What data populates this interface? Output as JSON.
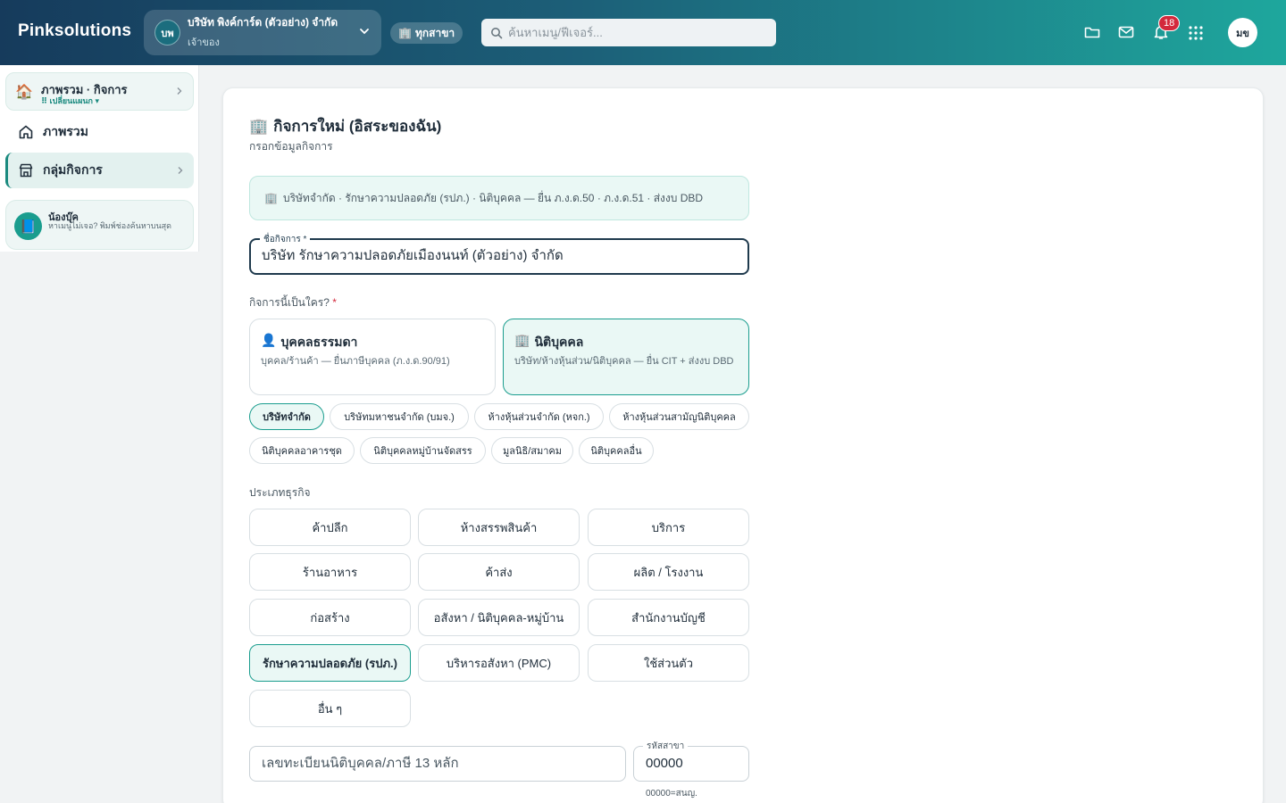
{
  "header": {
    "brand": "Pinksolutions",
    "company_initials": "บพ",
    "company_name": "บริษัท พิงค์การ์ด (ตัวอย่าง) จำกัด",
    "company_role": "เจ้าของ",
    "branch_label": "ทุกสาขา",
    "search_placeholder": "ค้นหาเมนู/ฟีเจอร์...",
    "notification_count": "18",
    "user_initials": "มข"
  },
  "sidebar": {
    "workspace_title": "ภาพรวม · กิจการ",
    "workspace_switch": "⠿ เปลี่ยนแผนก ▾",
    "items": [
      {
        "label": "ภาพรวม",
        "icon": "home-icon"
      },
      {
        "label": "กลุ่มกิจการ",
        "icon": "store-icon"
      }
    ],
    "helper_name": "น้องบุ๊ค",
    "helper_text": "หาเมนูไม่เจอ? พิมพ์ช่องค้นหาบนสุด"
  },
  "form": {
    "title": "กิจการใหม่ (อิสระของฉัน)",
    "subtitle": "กรอกข้อมูลกิจการ",
    "info_banner": "บริษัทจำกัด · รักษาความปลอดภัย (รปภ.) · นิติบุคคล — ยื่น ภ.ง.ด.50 · ภ.ง.ด.51 · ส่งงบ DBD",
    "name_label": "ชื่อกิจการ *",
    "name_value": "บริษัท รักษาความปลอดภัยเมืองนนท์ (ตัวอย่าง) จำกัด",
    "who_label": "กิจการนี้เป็นใคร?",
    "required_mark": "*",
    "types": [
      {
        "title": "บุคคลธรรมดา",
        "desc": "บุคคล/ร้านค้า — ยื่นภาษีบุคคล (ภ.ง.ด.90/91)",
        "selected": false
      },
      {
        "title": "นิติบุคคล",
        "desc": "บริษัท/ห้างหุ้นส่วน/นิติบุคคล — ยื่น CIT + ส่งงบ DBD",
        "selected": true
      }
    ],
    "entity_chips": [
      {
        "label": "บริษัทจำกัด",
        "selected": true
      },
      {
        "label": "บริษัทมหาชนจำกัด (บมจ.)",
        "selected": false
      },
      {
        "label": "ห้างหุ้นส่วนจำกัด (หจก.)",
        "selected": false
      },
      {
        "label": "ห้างหุ้นส่วนสามัญนิติบุคคล",
        "selected": false
      },
      {
        "label": "นิติบุคคลอาคารชุด",
        "selected": false
      },
      {
        "label": "นิติบุคคลหมู่บ้านจัดสรร",
        "selected": false
      },
      {
        "label": "มูลนิธิ/สมาคม",
        "selected": false
      },
      {
        "label": "นิติบุคคลอื่น",
        "selected": false
      }
    ],
    "business_label": "ประเภทธุรกิจ",
    "business_types": [
      {
        "label": "ค้าปลีก",
        "selected": false
      },
      {
        "label": "ห้างสรรพสินค้า",
        "selected": false
      },
      {
        "label": "บริการ",
        "selected": false
      },
      {
        "label": "ร้านอาหาร",
        "selected": false
      },
      {
        "label": "ค้าส่ง",
        "selected": false
      },
      {
        "label": "ผลิต / โรงงาน",
        "selected": false
      },
      {
        "label": "ก่อสร้าง",
        "selected": false
      },
      {
        "label": "อสังหา / นิติบุคคล-หมู่บ้าน",
        "selected": false
      },
      {
        "label": "สำนักงานบัญชี",
        "selected": false
      },
      {
        "label": "รักษาความปลอดภัย (รปภ.)",
        "selected": true
      },
      {
        "label": "บริหารอสังหา (PMC)",
        "selected": false
      },
      {
        "label": "ใช้ส่วนตัว",
        "selected": false
      },
      {
        "label": "อื่น ๆ",
        "selected": false
      }
    ],
    "tax_placeholder": "เลขทะเบียนนิติบุคคล/ภาษี 13 หลัก",
    "branch_code_label": "รหัสสาขา",
    "branch_code_value": "00000",
    "branch_code_hint": "00000=สนญ."
  },
  "colors": {
    "accent": "#1a9d8e",
    "header_start": "#163b5c",
    "header_end": "#1ea79d",
    "badge": "#d3293c"
  }
}
